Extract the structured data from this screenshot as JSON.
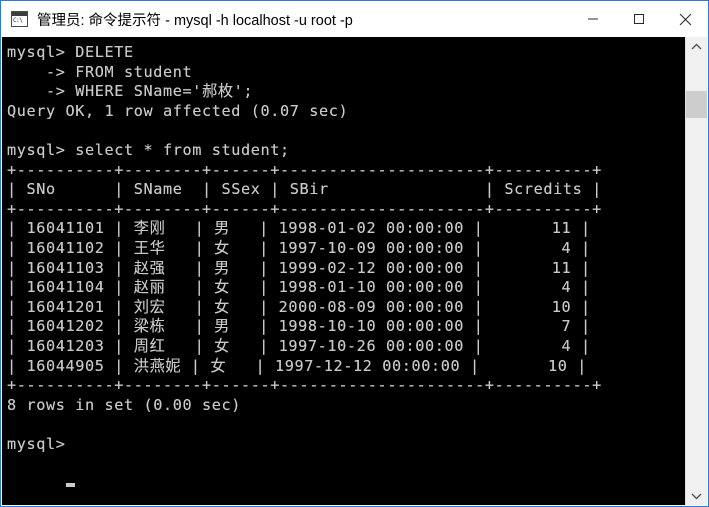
{
  "window": {
    "title": "管理员: 命令提示符 - mysql  -h localhost -u root -p",
    "icon": "console-window-icon",
    "icon_glyph": "C:\\",
    "border_color": "#2a7cd4",
    "titlebar_bg": "#ffffff",
    "controls": {
      "minimize_label": "—",
      "maximize_label": "□",
      "close_label": "✕"
    }
  },
  "console": {
    "bg_color": "#000000",
    "fg_color": "#c8c8c8",
    "font_size_px": 15.2,
    "line_height_px": 19.6,
    "cursor": "_",
    "lines": [
      "mysql> DELETE",
      "    -> FROM student",
      "    -> WHERE SName='郝枚';",
      "Query OK, 1 row affected (0.07 sec)",
      "",
      "mysql> select * from student;",
      "+----------+--------+------+---------------------+----------+",
      "| SNo      | SName  | SSex | SBir                | Scredits |",
      "+----------+--------+------+---------------------+----------+",
      "| 16041101 | 李刚   | 男   | 1998-01-02 00:00:00 |       11 |",
      "| 16041102 | 王华   | 女   | 1997-10-09 00:00:00 |        4 |",
      "| 16041103 | 赵强   | 男   | 1999-02-12 00:00:00 |       11 |",
      "| 16041104 | 赵丽   | 女   | 1998-01-10 00:00:00 |        4 |",
      "| 16041201 | 刘宏   | 女   | 2000-08-09 00:00:00 |       10 |",
      "| 16041202 | 梁栋   | 男   | 1998-10-10 00:00:00 |        7 |",
      "| 16041203 | 周红   | 女   | 1997-10-26 00:00:00 |        4 |",
      "| 16044905 | 洪燕妮 | 女   | 1997-12-12 00:00:00 |       10 |",
      "+----------+--------+------+---------------------+----------+",
      "8 rows in set (0.00 sec)",
      "",
      "mysql> "
    ],
    "commands": [
      {
        "prompt": "mysql>",
        "statement": "DELETE FROM student WHERE SName='郝枚';",
        "result": "Query OK, 1 row affected (0.07 sec)"
      },
      {
        "prompt": "mysql>",
        "statement": "select * from student;",
        "result": "8 rows in set (0.00 sec)"
      }
    ],
    "result_table": {
      "columns": [
        "SNo",
        "SName",
        "SSex",
        "SBir",
        "Scredits"
      ],
      "rows": [
        [
          "16041101",
          "李刚",
          "男",
          "1998-01-02 00:00:00",
          "11"
        ],
        [
          "16041102",
          "王华",
          "女",
          "1997-10-09 00:00:00",
          "4"
        ],
        [
          "16041103",
          "赵强",
          "男",
          "1999-02-12 00:00:00",
          "11"
        ],
        [
          "16041104",
          "赵丽",
          "女",
          "1998-01-10 00:00:00",
          "4"
        ],
        [
          "16041201",
          "刘宏",
          "女",
          "2000-08-09 00:00:00",
          "10"
        ],
        [
          "16041202",
          "梁栋",
          "男",
          "1998-10-10 00:00:00",
          "7"
        ],
        [
          "16041203",
          "周红",
          "女",
          "1997-10-26 00:00:00",
          "4"
        ],
        [
          "16044905",
          "洪燕妮",
          "女",
          "1997-12-12 00:00:00",
          "10"
        ]
      ],
      "row_count_text": "8 rows in set (0.00 sec)"
    }
  },
  "scrollbar": {
    "up_arrow": "˄",
    "down_arrow": "˅",
    "track_color": "#f0f0f0",
    "thumb_color": "#cdcdcd"
  }
}
